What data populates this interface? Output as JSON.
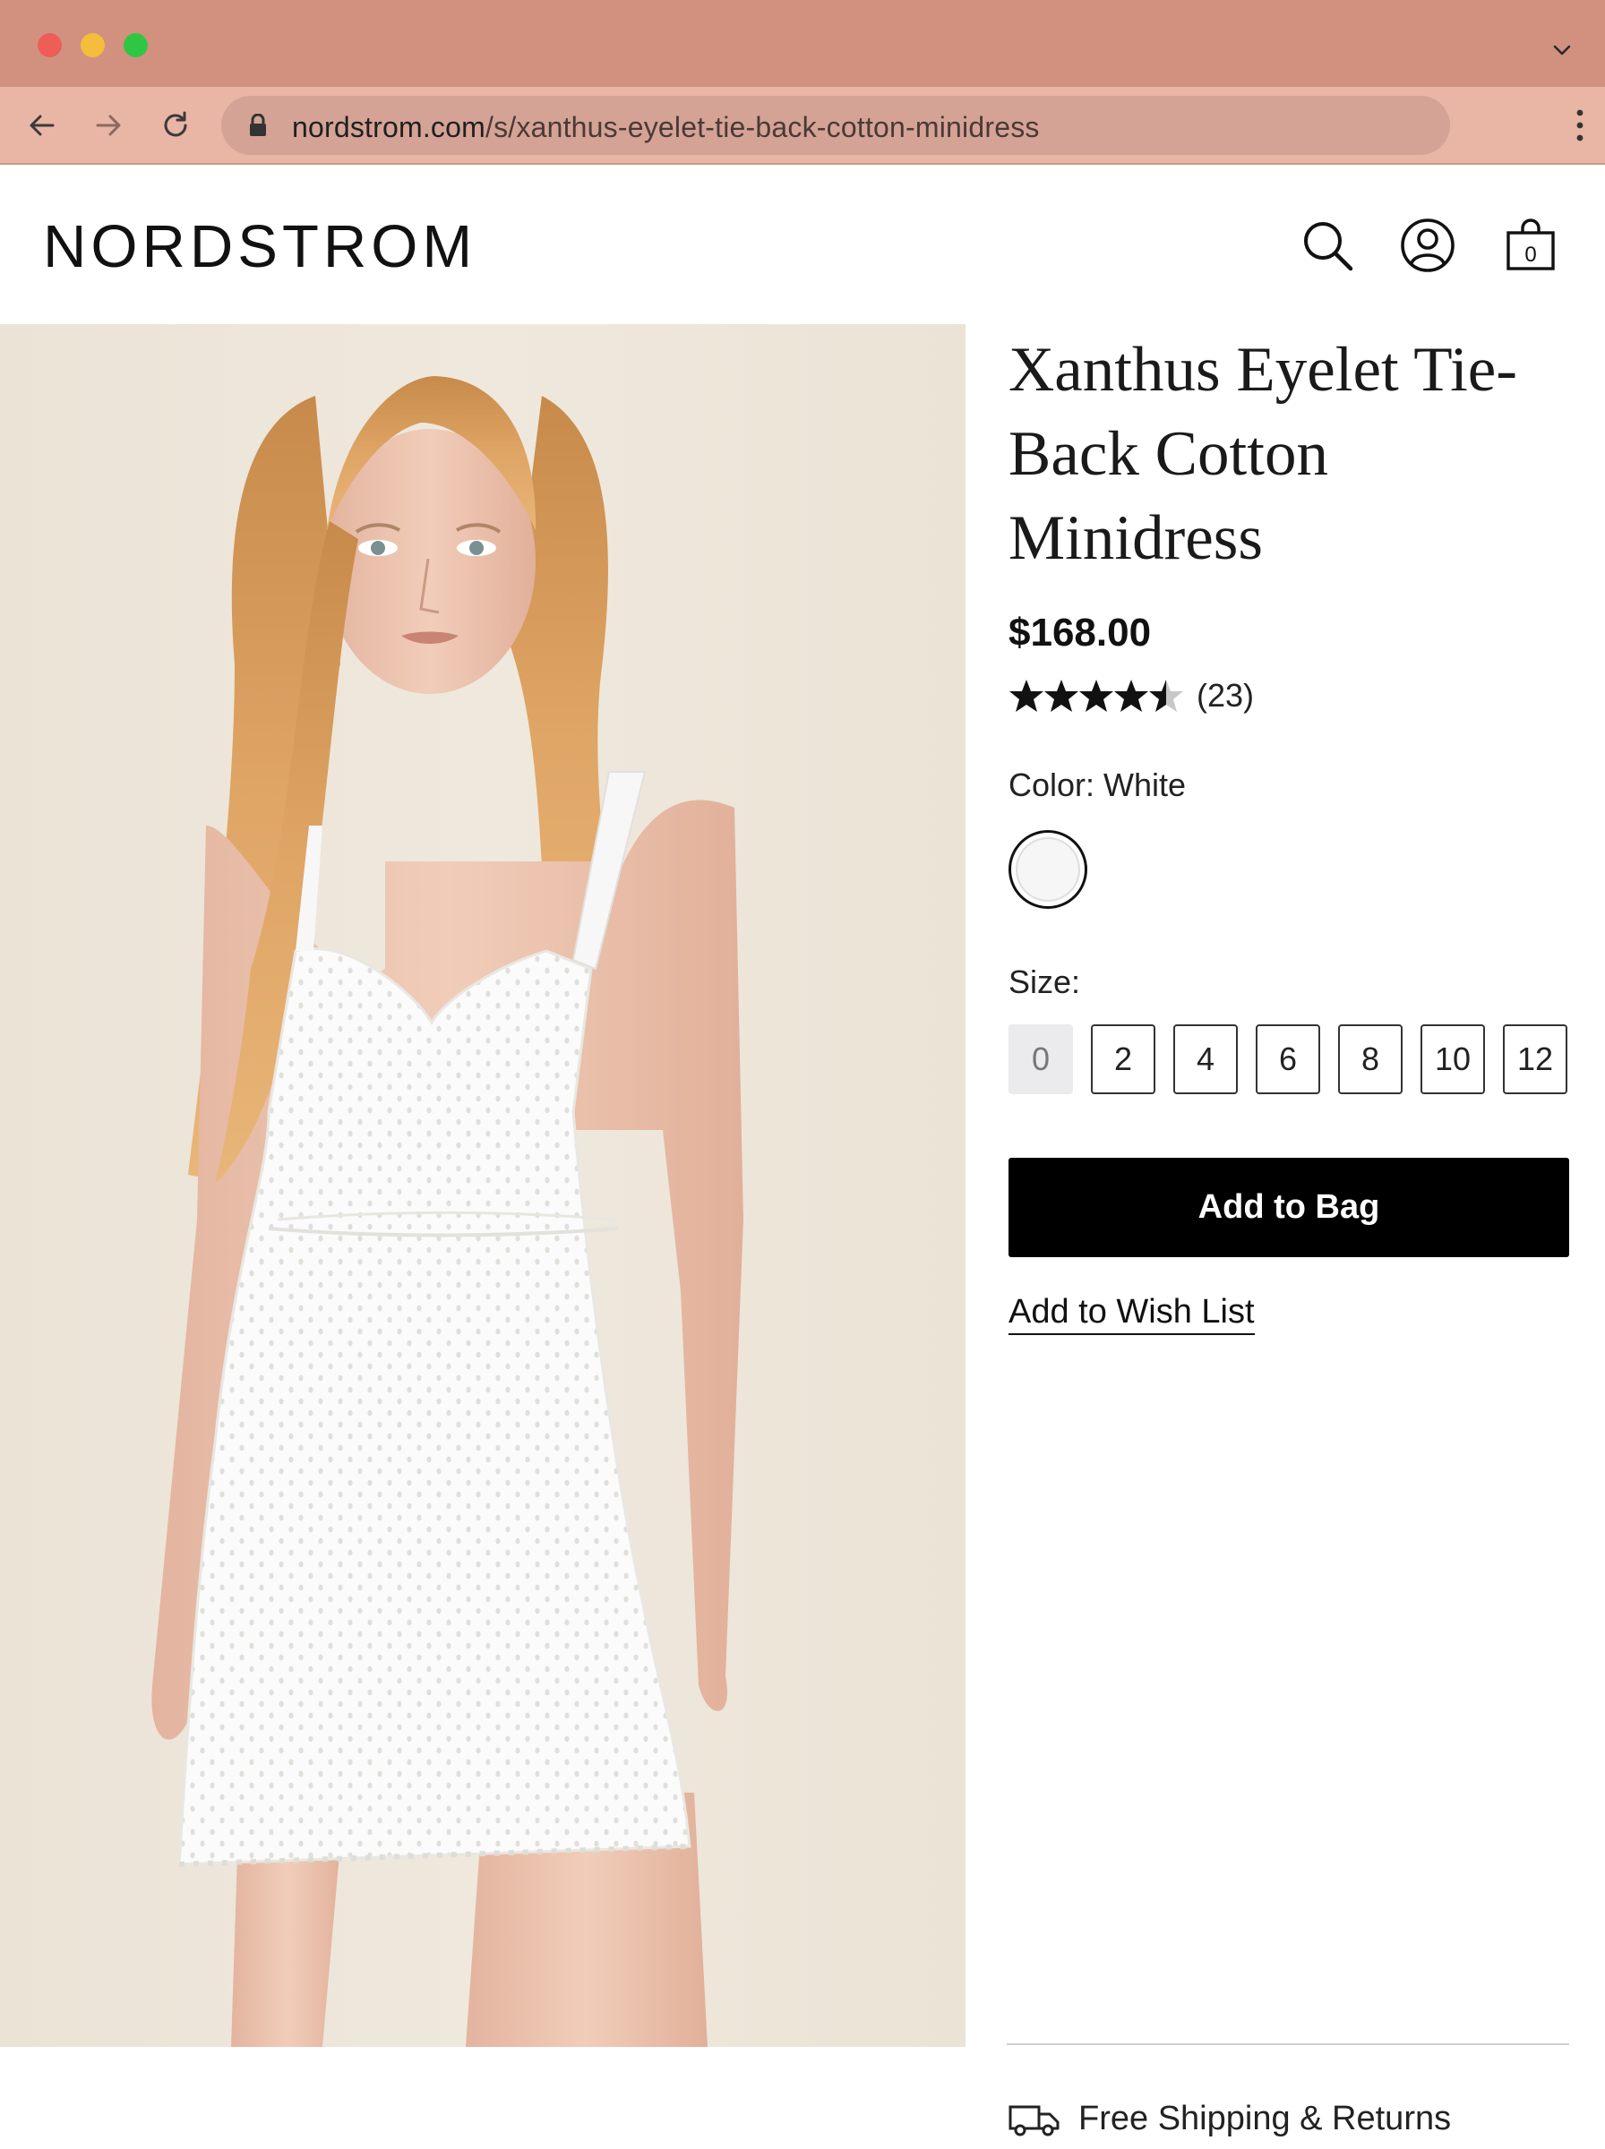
{
  "browser": {
    "url_host": "nordstrom.com",
    "url_path": "/s/xanthus-eyelet-tie-back-cotton-minidress",
    "icons": [
      "chevron-down-icon",
      "back-arrow-icon",
      "forward-arrow-icon",
      "reload-icon",
      "lock-icon",
      "kebab-menu-icon"
    ]
  },
  "header": {
    "logo": "NORDSTROM",
    "icons": [
      "search-icon",
      "account-icon",
      "shopping-bag-icon"
    ],
    "bag_count": "0"
  },
  "product": {
    "title": "Xanthus Eyelet Tie-Back Cotton Minidress",
    "price": "$168.00",
    "rating_value": 4.5,
    "rating_max": 5,
    "review_count": "(23)",
    "color_label": "Color: White",
    "color_swatch": "#f6f6f6",
    "size_label": "Size:",
    "sizes": [
      {
        "label": "0",
        "available": false
      },
      {
        "label": "2",
        "available": true
      },
      {
        "label": "4",
        "available": true
      },
      {
        "label": "6",
        "available": true
      },
      {
        "label": "8",
        "available": true
      },
      {
        "label": "10",
        "available": true
      },
      {
        "label": "12",
        "available": true
      }
    ],
    "add_to_bag": "Add to Bag",
    "wish_list": "Add to Wish List"
  },
  "footer": {
    "shipping": "Free Shipping & Returns",
    "shipping_icon": "truck-icon"
  },
  "colors": {
    "titlebar": "#d2917f",
    "toolbar": "#e9b5a5",
    "urlbar": "#d4a395",
    "primary_button": "#000000"
  }
}
